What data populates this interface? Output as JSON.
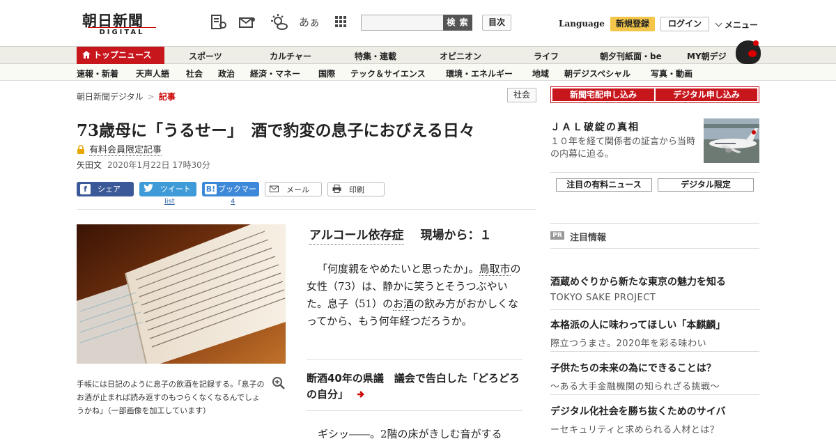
{
  "header": {
    "logo_main": "朝日新聞",
    "logo_sub": "DIGITAL",
    "search_placeholder": "",
    "search_label": "検 索",
    "toc_label": "目次",
    "language_label": "Language",
    "signup_label": "新規登録",
    "login_label": "ログイン",
    "menu_label": "メニュー",
    "font_icon_label": "あぁ"
  },
  "nav_primary": {
    "top_label": "トップニュース",
    "items": [
      "スポーツ",
      "カルチャー",
      "特集・連載",
      "オピニオン",
      "ライフ",
      "朝夕刊紙面・be",
      "MY朝デジ"
    ]
  },
  "nav_secondary": {
    "items": [
      "速報・新着",
      "天声人語",
      "社会",
      "政治",
      "経済・マネー",
      "国際",
      "テック＆サイエンス",
      "環境・エネルギー",
      "地域",
      "朝デジスペシャル",
      "写真・動画"
    ]
  },
  "breadcrumb": {
    "home": "朝日新聞デジタル",
    "separator": ">",
    "current": "記事"
  },
  "category_badge": "社会",
  "article": {
    "headline": "73歳母に「うるせー」　酒で豹変の息子におびえる日々",
    "members_only": "有料会員限定記事",
    "author": "矢田文",
    "date": "2020年1月22日 17時30分",
    "series_title": "アルコール依存症",
    "series_number": "現場から：１",
    "para1_a": "「何度親をやめたいと思ったか」。",
    "para1_link1": "鳥取市",
    "para1_b": "の女性（73）は、静かに笑うとそうつぶやいた。息子（51）の",
    "para1_link2": "お酒",
    "para1_c": "の飲み方がおかしくなってから、もう何年経つだろうか。",
    "related": "断酒40年の県議　議会で告白した「どろどろの自分」",
    "para2": "ギシッ――。2階の床がきしむ音がする",
    "caption": "手帳には日記のように息子の飲酒を記録する。「息子のお酒が止まれば読み返すのもつらくなくなるんでしょうかね」（一部画像を加工しています）"
  },
  "share": {
    "facebook": "シェア",
    "twitter": "ツイート",
    "twitter_count": "list",
    "hatena": "ブックマーク",
    "hatena_count": "4",
    "mail": "メール",
    "print": "印刷"
  },
  "sidebar": {
    "subscribe_paper": "新聞宅配申し込み",
    "subscribe_digital": "デジタル申し込み",
    "promo_title": "ＪＡＬ破綻の真相",
    "promo_desc": "１０年を経て関係者の証言から当時の内幕に迫る。",
    "tab1": "注目の有料ニュース",
    "tab2": "デジタル限定",
    "pr_badge": "PR",
    "pr_heading": "注目情報",
    "pr_items": [
      {
        "title": "酒蔵めぐりから新たな東京の魅力を知る",
        "sub": "TOKYO SAKE PROJECT"
      },
      {
        "title": "本格派の人に味わってほしい「本麒麟」",
        "sub": "際立つうまさ。2020年を彩る味わい"
      },
      {
        "title": "子供たちの未来の為にできることは？",
        "sub": "～ある大手金融機関の知られざる挑戦～"
      },
      {
        "title": "デジタル化社会を勝ち抜くためのサイバ",
        "sub": "ーセキュリティと求められる人材とは？"
      }
    ]
  }
}
